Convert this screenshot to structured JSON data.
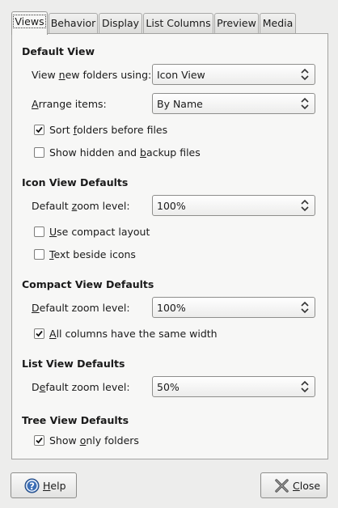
{
  "tabs": [
    {
      "label": "Views",
      "active": true
    },
    {
      "label": "Behavior"
    },
    {
      "label": "Display"
    },
    {
      "label": "List Columns"
    },
    {
      "label": "Preview"
    },
    {
      "label": "Media"
    }
  ],
  "default_view": {
    "heading": "Default View",
    "new_folders": {
      "pre": "View ",
      "mnemonic": "n",
      "post": "ew folders using:",
      "value": "Icon View"
    },
    "arrange": {
      "pre": "",
      "mnemonic": "A",
      "post": "rrange items:",
      "value": "By Name"
    },
    "sort_folders": {
      "pre": "Sort ",
      "mnemonic": "f",
      "post": "olders before files",
      "checked": true
    },
    "show_hidden": {
      "pre": "Show hidden and ",
      "mnemonic": "b",
      "post": "ackup files",
      "checked": false
    }
  },
  "icon_view": {
    "heading": "Icon View Defaults",
    "zoom": {
      "pre": "Default ",
      "mnemonic": "z",
      "post": "oom level:",
      "value": "100%"
    },
    "compact_layout": {
      "pre": "",
      "mnemonic": "U",
      "post": "se compact layout",
      "checked": false
    },
    "text_beside": {
      "pre": "",
      "mnemonic": "T",
      "post": "ext beside icons",
      "checked": false
    }
  },
  "compact_view": {
    "heading": "Compact View Defaults",
    "zoom": {
      "pre": "",
      "mnemonic": "D",
      "post": "efault zoom level:",
      "value": "100%"
    },
    "same_width": {
      "pre": "",
      "mnemonic": "A",
      "post": "ll columns have the same width",
      "checked": true
    }
  },
  "list_view": {
    "heading": "List View Defaults",
    "zoom": {
      "pre": "D",
      "mnemonic": "e",
      "post": "fault zoom level:",
      "value": "50%"
    }
  },
  "tree_view": {
    "heading": "Tree View Defaults",
    "only_folders": {
      "pre": "Show ",
      "mnemonic": "o",
      "post": "nly folders",
      "checked": true
    }
  },
  "buttons": {
    "help": {
      "pre": "",
      "mnemonic": "H",
      "post": "elp",
      "icon": "help-icon"
    },
    "close": {
      "pre": "",
      "mnemonic": "C",
      "post": "lose",
      "icon": "close-icon"
    }
  }
}
